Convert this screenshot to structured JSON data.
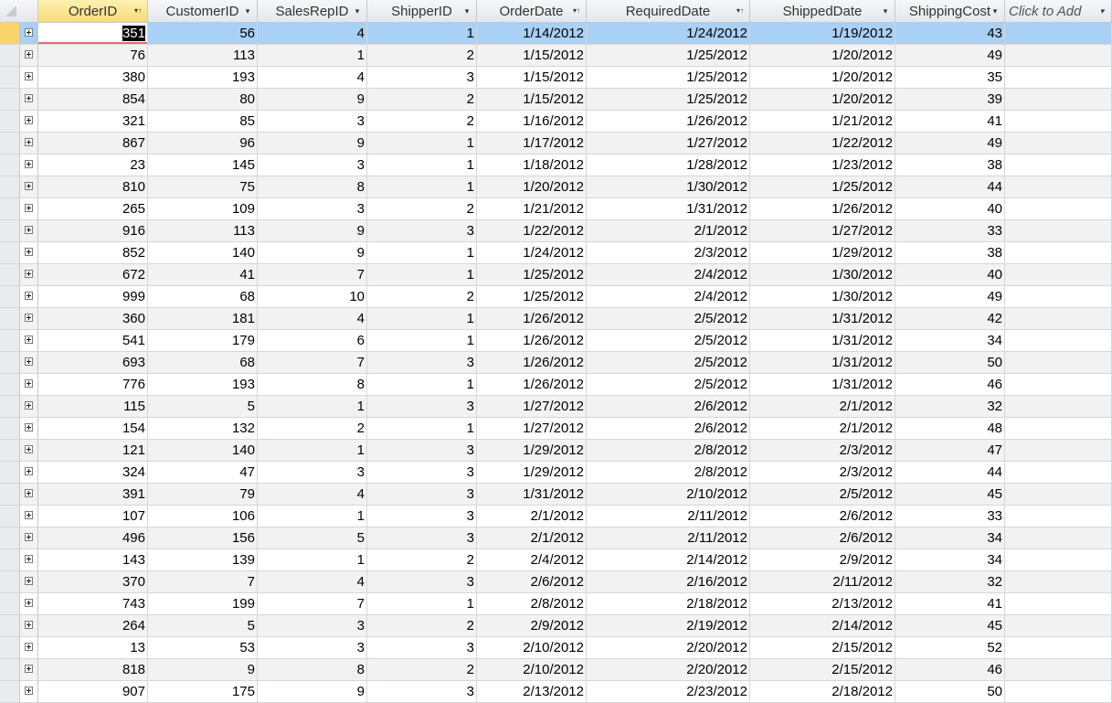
{
  "columns": [
    {
      "label": "OrderID",
      "sorted": true,
      "icon": "sort-filter-icon"
    },
    {
      "label": "CustomerID",
      "sorted": false,
      "icon": "dropdown-arrow-icon"
    },
    {
      "label": "SalesRepID",
      "sorted": false,
      "icon": "dropdown-arrow-icon"
    },
    {
      "label": "ShipperID",
      "sorted": false,
      "icon": "dropdown-arrow-icon"
    },
    {
      "label": "OrderDate",
      "sorted": false,
      "icon": "sort-filter-icon"
    },
    {
      "label": "RequiredDate",
      "sorted": false,
      "icon": "sort-filter-icon"
    },
    {
      "label": "ShippedDate",
      "sorted": false,
      "icon": "dropdown-arrow-icon"
    },
    {
      "label": "ShippingCost",
      "sorted": false,
      "icon": "dropdown-arrow-icon"
    },
    {
      "label": "Click to Add",
      "sorted": false,
      "icon": "dropdown-arrow-icon"
    }
  ],
  "selected_row": 0,
  "rows": [
    [
      "351",
      "56",
      "4",
      "1",
      "1/14/2012",
      "1/24/2012",
      "1/19/2012",
      "43",
      ""
    ],
    [
      "76",
      "113",
      "1",
      "2",
      "1/15/2012",
      "1/25/2012",
      "1/20/2012",
      "49",
      ""
    ],
    [
      "380",
      "193",
      "4",
      "3",
      "1/15/2012",
      "1/25/2012",
      "1/20/2012",
      "35",
      ""
    ],
    [
      "854",
      "80",
      "9",
      "2",
      "1/15/2012",
      "1/25/2012",
      "1/20/2012",
      "39",
      ""
    ],
    [
      "321",
      "85",
      "3",
      "2",
      "1/16/2012",
      "1/26/2012",
      "1/21/2012",
      "41",
      ""
    ],
    [
      "867",
      "96",
      "9",
      "1",
      "1/17/2012",
      "1/27/2012",
      "1/22/2012",
      "49",
      ""
    ],
    [
      "23",
      "145",
      "3",
      "1",
      "1/18/2012",
      "1/28/2012",
      "1/23/2012",
      "38",
      ""
    ],
    [
      "810",
      "75",
      "8",
      "1",
      "1/20/2012",
      "1/30/2012",
      "1/25/2012",
      "44",
      ""
    ],
    [
      "265",
      "109",
      "3",
      "2",
      "1/21/2012",
      "1/31/2012",
      "1/26/2012",
      "40",
      ""
    ],
    [
      "916",
      "113",
      "9",
      "3",
      "1/22/2012",
      "2/1/2012",
      "1/27/2012",
      "33",
      ""
    ],
    [
      "852",
      "140",
      "9",
      "1",
      "1/24/2012",
      "2/3/2012",
      "1/29/2012",
      "38",
      ""
    ],
    [
      "672",
      "41",
      "7",
      "1",
      "1/25/2012",
      "2/4/2012",
      "1/30/2012",
      "40",
      ""
    ],
    [
      "999",
      "68",
      "10",
      "2",
      "1/25/2012",
      "2/4/2012",
      "1/30/2012",
      "49",
      ""
    ],
    [
      "360",
      "181",
      "4",
      "1",
      "1/26/2012",
      "2/5/2012",
      "1/31/2012",
      "42",
      ""
    ],
    [
      "541",
      "179",
      "6",
      "1",
      "1/26/2012",
      "2/5/2012",
      "1/31/2012",
      "34",
      ""
    ],
    [
      "693",
      "68",
      "7",
      "3",
      "1/26/2012",
      "2/5/2012",
      "1/31/2012",
      "50",
      ""
    ],
    [
      "776",
      "193",
      "8",
      "1",
      "1/26/2012",
      "2/5/2012",
      "1/31/2012",
      "46",
      ""
    ],
    [
      "115",
      "5",
      "1",
      "3",
      "1/27/2012",
      "2/6/2012",
      "2/1/2012",
      "32",
      ""
    ],
    [
      "154",
      "132",
      "2",
      "1",
      "1/27/2012",
      "2/6/2012",
      "2/1/2012",
      "48",
      ""
    ],
    [
      "121",
      "140",
      "1",
      "3",
      "1/29/2012",
      "2/8/2012",
      "2/3/2012",
      "47",
      ""
    ],
    [
      "324",
      "47",
      "3",
      "3",
      "1/29/2012",
      "2/8/2012",
      "2/3/2012",
      "44",
      ""
    ],
    [
      "391",
      "79",
      "4",
      "3",
      "1/31/2012",
      "2/10/2012",
      "2/5/2012",
      "45",
      ""
    ],
    [
      "107",
      "106",
      "1",
      "3",
      "2/1/2012",
      "2/11/2012",
      "2/6/2012",
      "33",
      ""
    ],
    [
      "496",
      "156",
      "5",
      "3",
      "2/1/2012",
      "2/11/2012",
      "2/6/2012",
      "34",
      ""
    ],
    [
      "143",
      "139",
      "1",
      "2",
      "2/4/2012",
      "2/14/2012",
      "2/9/2012",
      "34",
      ""
    ],
    [
      "370",
      "7",
      "4",
      "3",
      "2/6/2012",
      "2/16/2012",
      "2/11/2012",
      "32",
      ""
    ],
    [
      "743",
      "199",
      "7",
      "1",
      "2/8/2012",
      "2/18/2012",
      "2/13/2012",
      "41",
      ""
    ],
    [
      "264",
      "5",
      "3",
      "2",
      "2/9/2012",
      "2/19/2012",
      "2/14/2012",
      "45",
      ""
    ],
    [
      "13",
      "53",
      "3",
      "3",
      "2/10/2012",
      "2/20/2012",
      "2/15/2012",
      "52",
      ""
    ],
    [
      "818",
      "9",
      "8",
      "2",
      "2/10/2012",
      "2/20/2012",
      "2/15/2012",
      "46",
      ""
    ],
    [
      "907",
      "175",
      "9",
      "3",
      "2/13/2012",
      "2/23/2012",
      "2/18/2012",
      "50",
      ""
    ]
  ]
}
